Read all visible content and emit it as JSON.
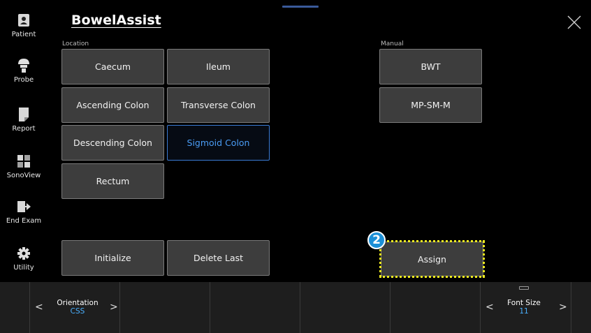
{
  "app": {
    "title": "BowelAssist"
  },
  "sidebar": {
    "items": [
      {
        "label": "Patient",
        "icon": "patient-icon"
      },
      {
        "label": "Probe",
        "icon": "probe-icon"
      },
      {
        "label": "Report",
        "icon": "report-icon"
      },
      {
        "label": "SonoView",
        "icon": "sonoview-icon"
      },
      {
        "label": "End Exam",
        "icon": "end-exam-icon"
      },
      {
        "label": "Utility",
        "icon": "gear-icon"
      }
    ]
  },
  "location": {
    "label": "Location",
    "buttons": [
      "Caecum",
      "Ileum",
      "Ascending Colon",
      "Transverse Colon",
      "Descending Colon",
      "Sigmoid Colon",
      "Rectum"
    ],
    "selected": "Sigmoid Colon"
  },
  "manual": {
    "label": "Manual",
    "buttons": [
      "BWT",
      "MP-SM-M"
    ]
  },
  "actions": {
    "initialize": "Initialize",
    "delete_last": "Delete Last",
    "assign": "Assign"
  },
  "callout": {
    "number": "2",
    "highlight_color": "#f2ee21",
    "badge_color": "#1c8fd6"
  },
  "bottom_bar": {
    "orientation": {
      "label": "Orientation",
      "value": "CSS"
    },
    "font_size": {
      "label": "Font Size",
      "value": "11"
    },
    "prev_arrow": "<",
    "next_arrow": ">"
  },
  "colors": {
    "accent": "#4a9cf5",
    "selected_border": "#3a7bd5"
  }
}
